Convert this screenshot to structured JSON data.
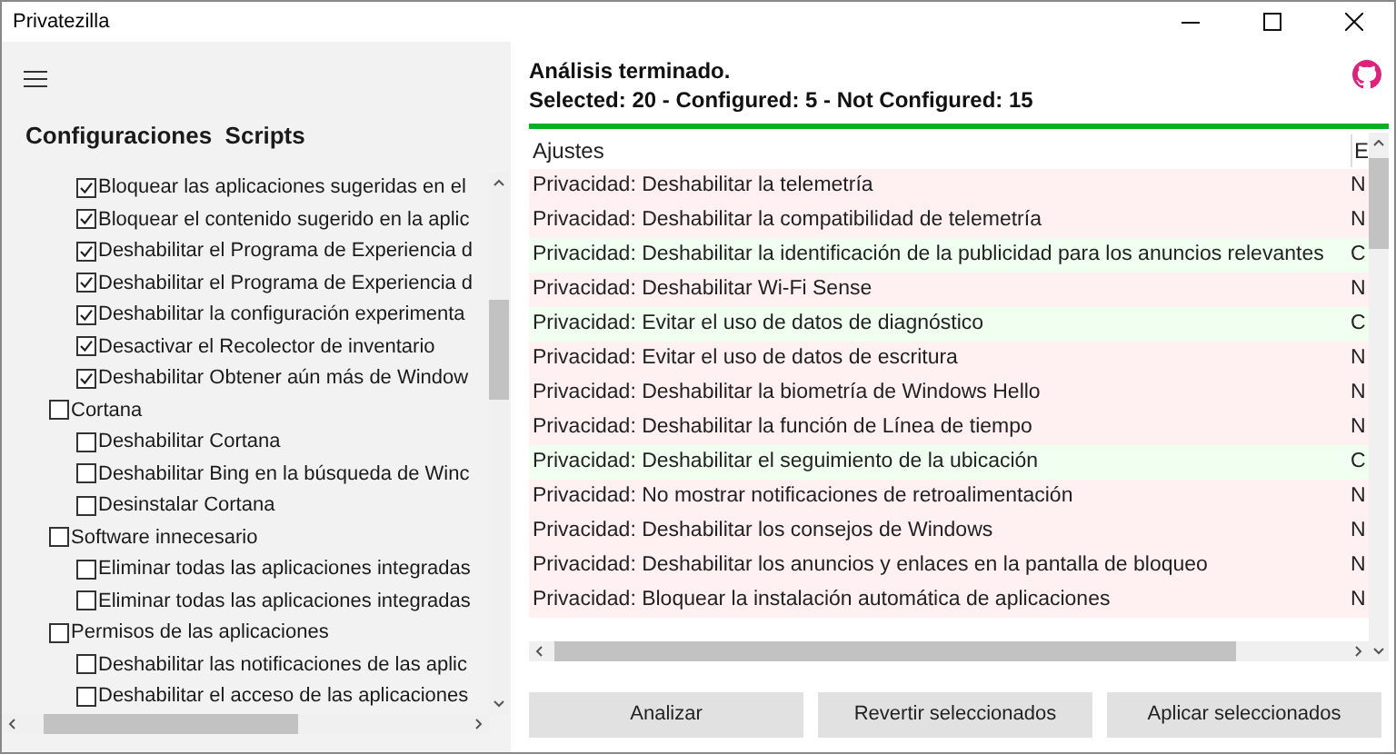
{
  "window": {
    "title": "Privatezilla"
  },
  "sidebar": {
    "heading": "Configuraciones  Scripts",
    "tree": [
      {
        "children": [
          {
            "label": "Bloquear las aplicaciones sugeridas en el",
            "checked": true
          },
          {
            "label": "Bloquear el contenido sugerido en la aplic",
            "checked": true
          },
          {
            "label": "Deshabilitar el Programa de Experiencia d",
            "checked": true
          },
          {
            "label": "Deshabilitar el Programa de Experiencia d",
            "checked": true
          },
          {
            "label": "Deshabilitar la configuración experimenta",
            "checked": true
          },
          {
            "label": "Desactivar el Recolector de inventario",
            "checked": true
          },
          {
            "label": "Deshabilitar Obtener aún más de Window",
            "checked": true
          }
        ]
      },
      {
        "label": "Cortana",
        "checked": false,
        "children": [
          {
            "label": "Deshabilitar Cortana",
            "checked": false
          },
          {
            "label": "Deshabilitar Bing en la búsqueda de Winc",
            "checked": false
          },
          {
            "label": "Desinstalar Cortana",
            "checked": false
          }
        ]
      },
      {
        "label": "Software innecesario",
        "checked": false,
        "children": [
          {
            "label": "Eliminar todas las aplicaciones integradas",
            "checked": false
          },
          {
            "label": "Eliminar todas las aplicaciones integradas",
            "checked": false
          }
        ]
      },
      {
        "label": "Permisos de las aplicaciones",
        "checked": false,
        "children": [
          {
            "label": "Deshabilitar las notificaciones de las aplic",
            "checked": false
          },
          {
            "label": "Deshabilitar el acceso de las aplicaciones",
            "checked": false
          }
        ]
      }
    ]
  },
  "status": {
    "line_1": "Análisis terminado.",
    "line_2": "Selected: 20 - Configured: 5 - Not Configured: 15",
    "level": 1
  },
  "table": {
    "columns": [
      "Ajustes",
      "E"
    ],
    "rows": [
      {
        "setting": "Privacidad: Deshabilitar la telemetría",
        "column_2": "N",
        "configured": false
      },
      {
        "setting": "Privacidad: Deshabilitar la compatibilidad de telemetría",
        "column_2": "N",
        "configured": false
      },
      {
        "setting": "Privacidad: Deshabilitar la identificación de la publicidad para los anuncios relevantes",
        "column_2": "C",
        "configured": true
      },
      {
        "setting": "Privacidad: Deshabilitar Wi-Fi Sense",
        "column_2": "N",
        "configured": false
      },
      {
        "setting": "Privacidad: Evitar el uso de datos de diagnóstico",
        "column_2": "C",
        "configured": true
      },
      {
        "setting": "Privacidad: Evitar el uso de datos de escritura",
        "column_2": "N",
        "configured": false
      },
      {
        "setting": "Privacidad: Deshabilitar la biometría de Windows Hello",
        "column_2": "N",
        "configured": false
      },
      {
        "setting": "Privacidad: Deshabilitar la función de Línea de tiempo",
        "column_2": "N",
        "configured": false
      },
      {
        "setting": "Privacidad: Deshabilitar el seguimiento de la ubicación",
        "column_2": "C",
        "configured": true
      },
      {
        "setting": "Privacidad: No mostrar notificaciones de retroalimentación",
        "column_2": "N",
        "configured": false
      },
      {
        "setting": "Privacidad: Deshabilitar los consejos de Windows",
        "column_2": "N",
        "configured": false
      },
      {
        "setting": "Privacidad: Deshabilitar los anuncios y enlaces en la pantalla de bloqueo",
        "column_2": "N",
        "configured": false
      },
      {
        "setting": "Privacidad: Bloquear la instalación automática de aplicaciones",
        "column_2": "N",
        "configured": false
      }
    ]
  },
  "buttons": [
    "Analizar",
    "Revertir seleccionados",
    "Aplicar seleccionados"
  ]
}
